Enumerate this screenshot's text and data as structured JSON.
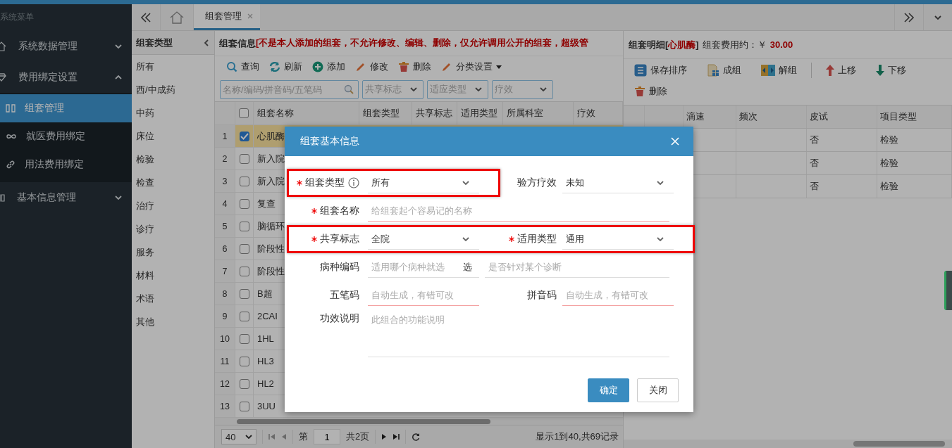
{
  "sidebar": {
    "title": "系统菜单",
    "items": [
      {
        "label": "系统数据管理",
        "expanded": false
      },
      {
        "label": "费用绑定设置",
        "expanded": true,
        "children": [
          {
            "label": "组套管理",
            "selected": true
          },
          {
            "label": "就医费用绑定",
            "selected": false
          },
          {
            "label": "用法费用绑定",
            "selected": false
          }
        ]
      },
      {
        "label": "基本信息管理",
        "expanded": false
      }
    ]
  },
  "tabs": [
    {
      "label": "组套管理",
      "selected": true
    }
  ],
  "category_panel": {
    "title": "组套类型",
    "items": [
      "所有",
      "西/中成药",
      "中药",
      "床位",
      "检验",
      "检查",
      "治疗",
      "诊疗",
      "服务",
      "材料",
      "术语",
      "其他"
    ]
  },
  "main_panel": {
    "title": "组套信息",
    "notice": "[不是本人添加的组套，不允许修改、编辑、删除，仅允许调用公开的组套，超级管",
    "toolbar": [
      {
        "label": "查询",
        "dropdown": false
      },
      {
        "label": "刷新",
        "dropdown": false
      },
      {
        "label": "添加",
        "dropdown": false
      },
      {
        "label": "修改",
        "dropdown": false
      },
      {
        "label": "删除",
        "dropdown": false
      },
      {
        "label": "分类设置",
        "dropdown": true
      }
    ],
    "search_placeholder": "名称/编码/拼音码/五笔码",
    "filters": [
      "共享标志",
      "适应类型",
      "疗效"
    ],
    "table": {
      "all_checked": false,
      "columns": [
        "组套名称",
        "组套类型",
        "共享标志",
        "适用类型",
        "所属科室",
        "疗效"
      ],
      "rows": [
        {
          "number": "1",
          "name": "心肌酶",
          "checked": true,
          "selected": true
        },
        {
          "number": "2",
          "name": "新入院",
          "checked": false,
          "selected": false
        },
        {
          "number": "3",
          "name": "新入院",
          "checked": false,
          "selected": false
        },
        {
          "number": "4",
          "name": "复查",
          "checked": false,
          "selected": false
        },
        {
          "number": "5",
          "name": "脑循环",
          "checked": false,
          "selected": false
        },
        {
          "number": "6",
          "name": "阶段性",
          "checked": false,
          "selected": false
        },
        {
          "number": "7",
          "name": "阶段性",
          "checked": false,
          "selected": false
        },
        {
          "number": "8",
          "name": "B超",
          "checked": false,
          "selected": false
        },
        {
          "number": "9",
          "name": "2CAI",
          "checked": false,
          "selected": false
        },
        {
          "number": "10",
          "name": "1HL",
          "checked": false,
          "selected": false
        },
        {
          "number": "11",
          "name": "HL3",
          "checked": false,
          "selected": false
        },
        {
          "number": "12",
          "name": "HL2",
          "checked": false,
          "selected": false
        },
        {
          "number": "13",
          "name": "3UU",
          "checked": false,
          "selected": false
        }
      ]
    },
    "pager": {
      "page_size": "40",
      "page_prefix": "第",
      "page": "1",
      "page_total": "共2页",
      "summary": "显示1到40,共69记录"
    }
  },
  "detail_panel": {
    "title": "组套明细[",
    "group_name": "心肌酶",
    "title_end": "]",
    "cost_label": "组套费用约：￥",
    "cost": "30.00",
    "toolbar": [
      [
        "保存排序",
        "成组",
        "解组"
      ],
      [
        "上移",
        "下移",
        "删除"
      ]
    ],
    "table": {
      "columns": [
        "滴速",
        "频次",
        "皮试",
        "项目类型"
      ],
      "rows": [
        {
          "skin_test": "否",
          "item_type": "检验"
        },
        {
          "skin_test": "否",
          "item_type": "检验"
        },
        {
          "skin_test": "否",
          "item_type": "检验"
        }
      ]
    }
  },
  "modal": {
    "title": "组套基本信息",
    "rows": [
      {
        "fields": [
          {
            "label": "组套类型",
            "required": true,
            "info": true,
            "highlighted": true,
            "kind": "select",
            "value": "所有"
          },
          {
            "label": "验方疗效",
            "required": false,
            "info": false,
            "highlighted": false,
            "kind": "select",
            "value": "未知"
          }
        ]
      },
      {
        "fields": [
          {
            "label": "组套名称",
            "required": true,
            "info": false,
            "highlighted": false,
            "kind": "wide",
            "placeholder": "给组套起个容易记的名称",
            "invalid": true
          }
        ]
      },
      {
        "fields": [
          {
            "label": "共享标志",
            "required": true,
            "info": false,
            "highlighted": true,
            "kind": "select",
            "value": "全院"
          },
          {
            "label": "适用类型",
            "required": true,
            "info": false,
            "highlighted": true,
            "kind": "select",
            "value": "通用"
          }
        ]
      },
      {
        "fields": [
          {
            "label": "病种编码",
            "required": false,
            "info": false,
            "highlighted": false,
            "kind": "picker",
            "placeholder": "适用哪个病种就选",
            "button": "选",
            "extra_placeholder": "是否针对某个诊断",
            "invalid": false
          }
        ]
      },
      {
        "fields": [
          {
            "label": "五笔码",
            "required": false,
            "info": false,
            "highlighted": false,
            "kind": "text",
            "placeholder": "自动生成，有错可改",
            "invalid": true
          },
          {
            "label": "拼音码",
            "required": false,
            "info": false,
            "highlighted": false,
            "kind": "text",
            "placeholder": "自动生成，有错可改",
            "invalid": true
          }
        ]
      },
      {
        "fields": [
          {
            "label": "功效说明",
            "required": false,
            "info": false,
            "highlighted": false,
            "kind": "textarea",
            "placeholder": "此组合的功能说明",
            "invalid": false
          }
        ]
      }
    ],
    "buttons": [
      {
        "label": "确定",
        "primary": true
      },
      {
        "label": "关闭",
        "primary": false
      }
    ]
  }
}
